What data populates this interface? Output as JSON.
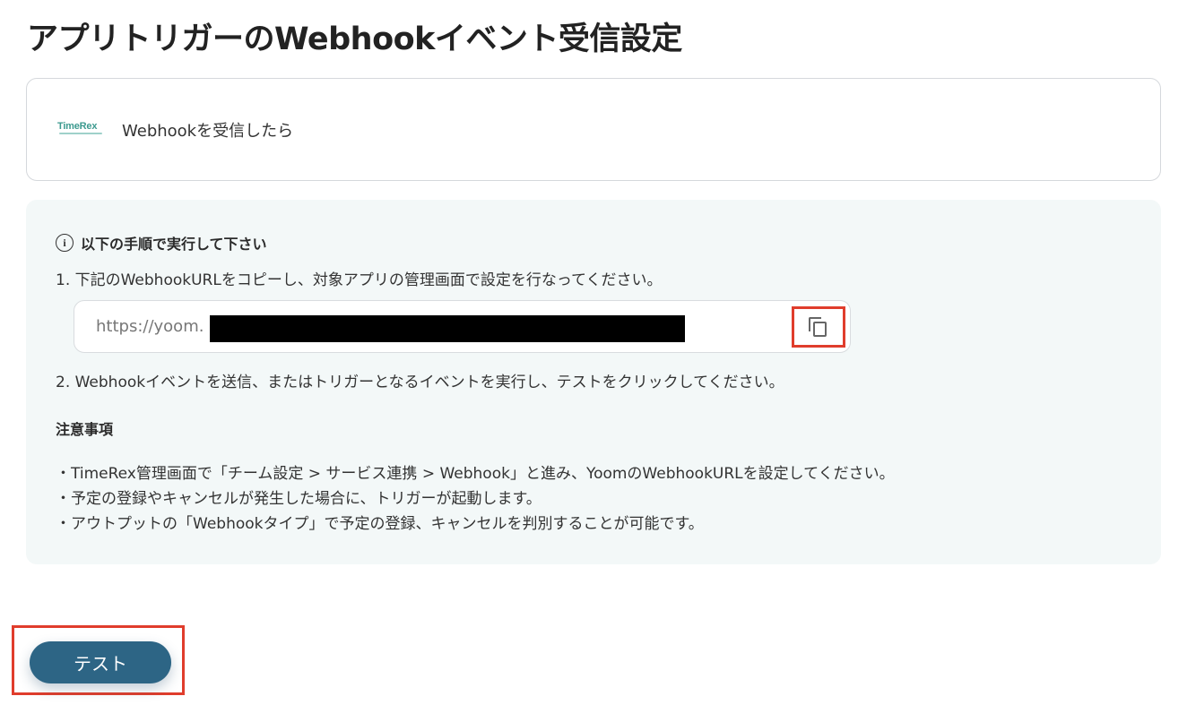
{
  "page": {
    "title": "アプリトリガーのWebhookイベント受信設定"
  },
  "trigger": {
    "app_logo_text": "TimeRex",
    "label": "Webhookを受信したら"
  },
  "instructions": {
    "heading": "以下の手順で実行して下さい",
    "step1": "1. 下記のWebhookURLをコピーし、対象アプリの管理画面で設定を行なってください。",
    "webhook_url_visible": "https://yoom.",
    "step2": "2. Webhookイベントを送信、またはトリガーとなるイベントを実行し、テストをクリックしてください。"
  },
  "notes": {
    "heading": "注意事項",
    "items": [
      "・TimeRex管理画面で「チーム設定 > サービス連携 > Webhook」と進み、YoomのWebhookURLを設定してください。",
      "・予定の登録やキャンセルが発生した場合に、トリガーが起動します。",
      "・アウトプットの「Webhookタイプ」で予定の登録、キャンセルを判別することが可能です。"
    ]
  },
  "actions": {
    "test_label": "テスト"
  },
  "colors": {
    "accent_button": "#2d6585",
    "highlight_border": "#e03d2c",
    "panel_bg": "#f3f8f8",
    "logo_teal": "#3c9a8f"
  },
  "icons": {
    "info": "info-icon",
    "copy": "copy-icon"
  }
}
